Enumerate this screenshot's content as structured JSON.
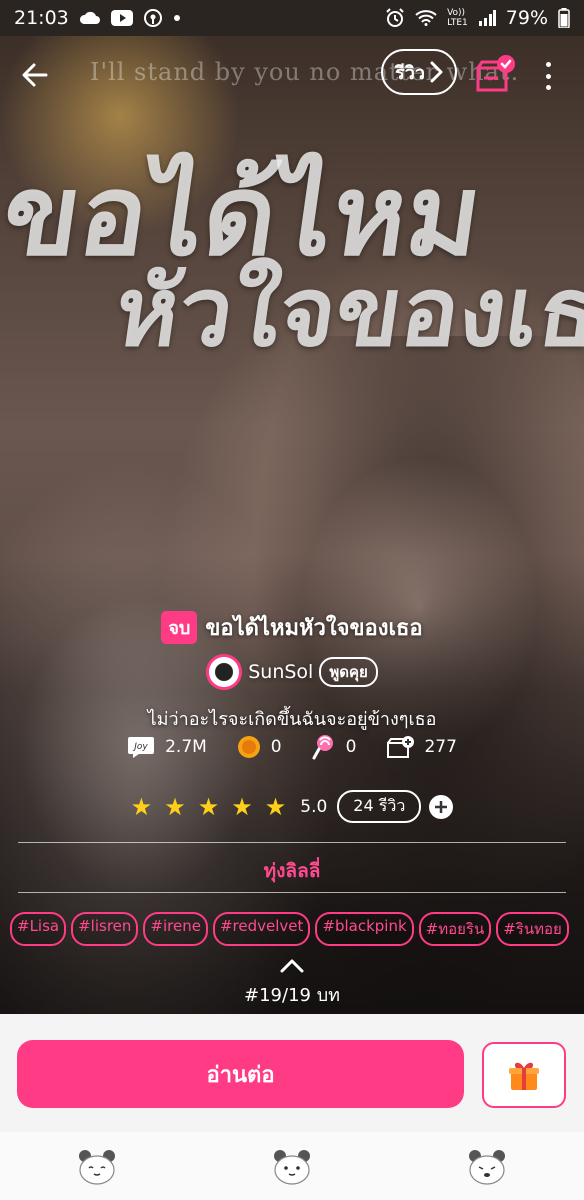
{
  "status_bar": {
    "time": "21:03",
    "battery": "79%",
    "network_top": "Vo))",
    "network_bottom": "LTE1"
  },
  "cover": {
    "tagline": "I'll stand by you no matter what.",
    "title_line1": "ขอได้ไหม",
    "title_line2": "หัวใจของเธ"
  },
  "top_bar": {
    "review_label": "รีวิว"
  },
  "story": {
    "status_tag": "จบ",
    "title": "ขอได้ไหมหัวใจของเธอ",
    "author": "SunSol",
    "chat_label": "พูดคุย",
    "synopsis": "ไม่ว่าอะไรจะเกิดขึ้นฉันจะอยู่ข้างๆเธอ",
    "stats": {
      "views": "2.7M",
      "coins": "0",
      "lollipops": "0",
      "library_adds": "277"
    },
    "rating": {
      "stars": 5,
      "value": "5.0",
      "reviews": "24 รีวิว"
    },
    "category": "ทุ่งลิลลี่",
    "tags": [
      "#Lisa",
      "#lisren",
      "#irene",
      "#redvelvet",
      "#blackpink",
      "#ทอยริน",
      "#รินทอย"
    ],
    "episode_count": "#19/19 บท"
  },
  "actions": {
    "read_label": "อ่านต่อ"
  },
  "colors": {
    "accent": "#ff3b86",
    "star": "#ffcf1a",
    "action_bg": "#f4f4f4"
  }
}
